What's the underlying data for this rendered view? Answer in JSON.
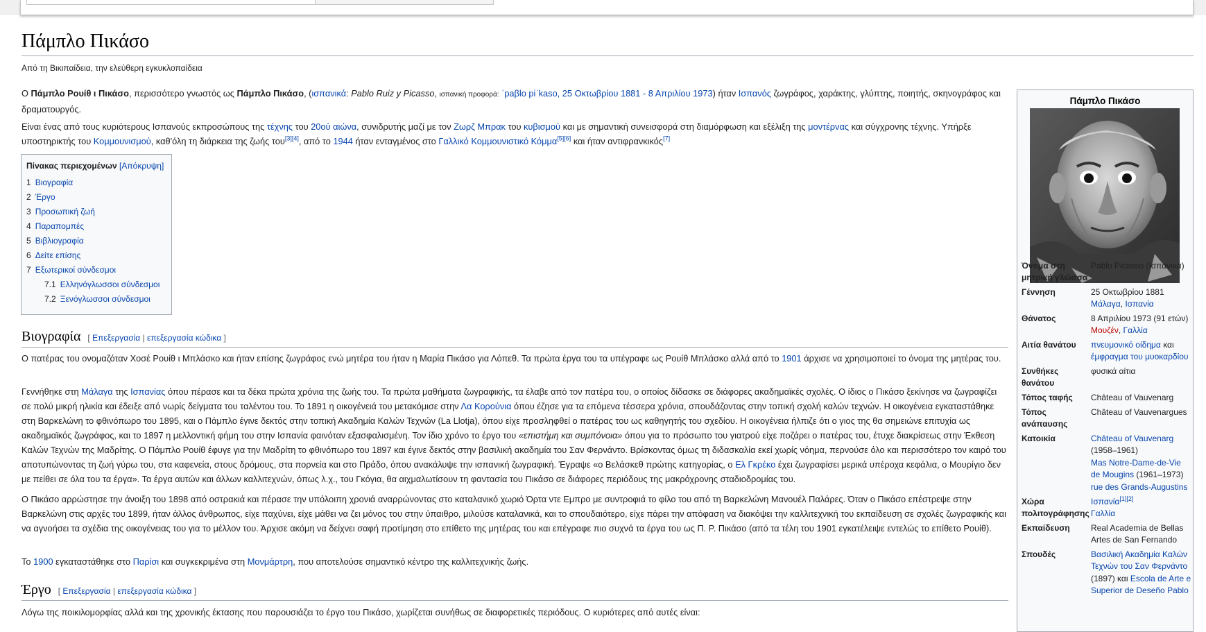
{
  "article": {
    "title": "Πάμπλο Πικάσο",
    "subtitle": "Από τη Βικιπαίδεια, την ελεύθερη εγκυκλοπαίδεια"
  },
  "intro": {
    "p1": {
      "a": "Ο ",
      "b": "Πάμπλο Ρουίθ ι Πικάσο",
      "c": ", περισσότερο γνωστός ως ",
      "d": "Πάμπλο Πικάσο",
      "e": ", (",
      "f": "ισπανικά",
      "g": ": ",
      "h": "Pablo Ruiz y Picasso",
      "i": ", ",
      "j": "ισπανική προφορά:",
      "k": " ˈpaβlo piˈkaso, 25 Οκτωβρίου 1881 - 8 Απριλίου 1973",
      "l": ") ήταν ",
      "m": "Ισπανός",
      "n": " ζωγράφος, χαράκτης, γλύπτης, ποιητής, σκηνογράφος και δραματουργός."
    },
    "p2": {
      "a": "Είναι ένας από τους κυριότερους Ισπανούς εκπροσώπους της ",
      "b": "τέχνης",
      "c": " του ",
      "d": "20ού αιώνα",
      "e": ", συνιδρυτής μαζί με τον ",
      "f": "Ζωρζ Μπρακ",
      "g": " του ",
      "h": "κυβισμού",
      "i": " και με σημαντική συνεισφορά στη διαμόρφωση και εξέλιξη της ",
      "j": "μοντέρνας",
      "k": " και σύγχρονης τέχνης. Υπήρξε υποστηρικτής του ",
      "l": "Κομμουνισμού",
      "m": ", καθ'όλη τη διάρκεια της ζωής του",
      "n": "[3][4]",
      "o": ", από το ",
      "p": "1944",
      "q": " ήταν ενταγμένος στο ",
      "r": "Γαλλικό Κομμουνιστικό Κόμμα",
      "s": "[5][6]",
      "t": " και ήταν αντιφρανκικός",
      "u": "[7]"
    }
  },
  "toc": {
    "title": "Πίνακας περιεχομένων",
    "toggle": "[Απόκρυψη]",
    "items": [
      {
        "num": "1",
        "label": "Βιογραφία"
      },
      {
        "num": "2",
        "label": "Έργο"
      },
      {
        "num": "3",
        "label": "Προσωπική ζωή"
      },
      {
        "num": "4",
        "label": "Παραπομπές"
      },
      {
        "num": "5",
        "label": "Βιβλιογραφία"
      },
      {
        "num": "6",
        "label": "Δείτε επίσης"
      },
      {
        "num": "7",
        "label": "Εξωτερικοί σύνδεσμοι"
      },
      {
        "num": "7.1",
        "label": "Ελληνόγλωσσοι σύνδεσμοι"
      },
      {
        "num": "7.2",
        "label": "Ξενόγλωσσοι σύνδεσμοι"
      }
    ]
  },
  "sections": {
    "bio": {
      "heading": "Βιογραφία",
      "edit_open": "[ ",
      "edit": "Επεξεργασία",
      "sep": " | ",
      "edit_code": "επεξεργασία κώδικα",
      "edit_close": " ]"
    },
    "work": {
      "heading": "Έργο",
      "edit_open": "[ ",
      "edit": "Επεξεργασία",
      "sep": " | ",
      "edit_code": "επεξεργασία κώδικα",
      "edit_close": " ]"
    }
  },
  "bio": {
    "p1": {
      "a": "Ο πατέρας του ονομαζόταν Χοσέ Ρουίθ ι Μπλάσκο και ήταν επίσης ζωγράφος ενώ μητέρα του ήταν η Μαρία Πικάσο για Λόπεθ. Τα πρώτα έργα του τα υπέγραφε ως Ρουίθ Μπλάσκο αλλά από το ",
      "b": "1901",
      "c": " άρχισε να χρησιμοποιεί το όνομα της μητέρας του."
    },
    "p2": {
      "a": "Γεννήθηκε στη ",
      "b": "Μάλαγα",
      "c": " της ",
      "d": "Ισπανίας",
      "e": " όπου πέρασε και τα δέκα πρώτα χρόνια της ζωής του. Τα πρώτα μαθήματα ζωγραφικής, τα έλαβε από τον πατέρα του, ο οποίος δίδασκε σε διάφορες ακαδημαϊκές σχολές. Ο ίδιος ο Πικάσο ξεκίνησε να ζωγραφίζει σε πολύ μικρή ηλικία και έδειξε από νωρίς δείγματα του ταλέντου του. Το 1891 η οικογένειά του μετακόμισε στην ",
      "f": "Λα Κορούνια",
      "g": " όπου έζησε για τα επόμενα τέσσερα χρόνια, σπουδάζοντας στην τοπική σχολή καλών τεχνών. Η οικογένεια εγκαταστάθηκε στη Βαρκελώνη το φθινόπωρο του 1895, και ο Πάμπλο έγινε δεκτός στην τοπική Ακαδημία Καλών Τεχνών (La Llotja), όπου είχε προσληφθεί ο πατέρας του ως καθηγητής του σχεδίου. Η οικογένεια ήλπιζε ότι ο γιος της θα σημειώνε επιτυχία ως ακαδημαϊκός ζωγράφος, και το 1897 η μελλοντική φήμη του στην Ισπανία φαινόταν εξασφαλισμένη. Τον ίδιο χρόνο το έργο του ",
      "h": "«επιστήμη και συμπόνοια»",
      "i": " όπου για το πρόσωπο του γιατρού είχε ποζάρει ο πατέρας του, έτυχε διακρίσεως στην Έκθεση Καλών Τεχνών της Μαδρίτης. Ο Πάμπλο Ρουίθ έφυγε για την Μαδρίτη το φθινόπωρο του 1897 και έγινε δεκτός στην βασιλική ακαδημία του Σαν Φερνάντο. Βρίσκοντας όμως τη διδασκαλία εκεί χωρίς νόημα, περνούσε όλο και περισσότερο τον καιρό του αποτυπώνοντας τη ζωή γύρω του, στα καφενεία, στους δρόμους, στα πορνεία και στο Πράδο, όπου ανακάλυψε την ισπανική ζωγραφική. Έγραψε «ο Βελάσκεθ πρώτης κατηγορίας, ο ",
      "j": "Ελ Γκρέκο",
      "k": " έχει ζωγραφίσει μερικά υπέροχα κεφάλια, ο Μουρίγιο δεν με πείθει σε όλα του τα έργα». Τα έργα αυτών και άλλων καλλιτεχνών, όπως λ.χ., του Γκόγια, θα αιχμαλωτίσουν τη φαντασία του Πικάσο σε διάφορες περιόδους της μακρόχρονης σταδιοδρομίας του."
    },
    "p3": "Ο Πικάσο αρρώστησε την άνοιξη του 1898 από οστρακιά και πέρασε την υπόλοιπη χρονιά αναρρώνοντας στο καταλανικό χωριό Όρτα ντε Εμπρο με συντροφιά το φίλο του από τη Βαρκελώνη Μανουέλ Παλάρες. Όταν ο Πικάσο επέστρεψε στην Βαρκελώνη στις αρχές του 1899, ήταν άλλος άνθρωπος, είχε παχύνει, είχε μάθει να ζει μόνος του στην ύπαιθρο, μιλούσε καταλανικά, και το σπουδαιότερο, είχε πάρει την απόφαση να διακόψει την καλλιτεχνική του εκπαίδευση σε σχολές ζωγραφικής και να αγνοήσει τα σχέδια της οικογένειας του για το μέλλον του. Άρχισε ακόμη να δείχνει σαφή προτίμηση στο επίθετο της μητέρας του και επέγραφε πιο συχνά τα έργα του ως Π. Ρ. Πικάσο (από τα τέλη του 1901 εγκατέλειψε εντελώς το επίθετο Ρουίθ).",
    "p4": {
      "a": "Το ",
      "b": "1900",
      "c": " εγκαταστάθηκε στο ",
      "d": "Παρίσι",
      "e": " και συγκεκριμένα στη ",
      "f": "Μονμάρτρη",
      "g": ", που αποτελούσε σημαντικό κέντρο της καλλιτεχνικής ζωής."
    }
  },
  "work": {
    "p1": "Λόγω της ποικιλομορφίας αλλά και της χρονικής έκτασης που παρουσιάζει το έργο του Πικάσο, χωρίζεται συνήθως σε διαφορετικές περιόδους. Ο κυριότερες από αυτές είναι:"
  },
  "infobox": {
    "title": "Πάμπλο Πικάσο",
    "rows": {
      "native_name": {
        "label": "Όνομα στη μητρική γλώσσα",
        "value": "Pablo Picasso (Ισπανικά)"
      },
      "birth": {
        "label": "Γέννηση",
        "date": "25 Οκτωβρίου 1881",
        "place_a": "Μάλαγα",
        "comma": ", ",
        "place_b": "Ισπανία"
      },
      "death": {
        "label": "Θάνατος",
        "date": "8 Απριλίου 1973 (91 ετών)",
        "place_a": "Μουζέν",
        "comma": ", ",
        "place_b": "Γαλλία"
      },
      "cause": {
        "label": "Αιτία θανάτου",
        "a": "πνευμονικό οίδημα",
        "b": " και ",
        "c": "έμφραγμα του μυοκαρδίου"
      },
      "manner": {
        "label": "Συνθήκες θανάτου",
        "value": "φυσικά αίτια"
      },
      "burial": {
        "label": "Τόπος ταφής",
        "value": "Château of Vauvenarg"
      },
      "rest": {
        "label": "Τόπος ανάπαυσης",
        "value": "Château of Vauvenargues"
      },
      "residence": {
        "label": "Κατοικία",
        "a": "Château of Vauvenarg",
        "b": " (1958–1961)",
        "c": "Mas Notre-Dame-de-Vie de Mougins",
        "d": " (1961–1973)",
        "e": "rue des Grands-Augustins"
      },
      "citizenship": {
        "label": "Χώρα πολιτογράφησης",
        "a": "Ισπανία",
        "sup": "[1][2]",
        "b": "Γαλλία"
      },
      "education": {
        "label": "Εκπαίδευση",
        "value": "Real Academia de Bellas Artes de San Fernando"
      },
      "studies": {
        "label": "Σπουδές",
        "a": "Βασιλική Ακαδημία Καλών Τεχνών του Σαν Φερνάντο",
        "b": " (1897) και ",
        "c": "Escola de Arte e Superior de Deseño Pablo"
      }
    }
  }
}
